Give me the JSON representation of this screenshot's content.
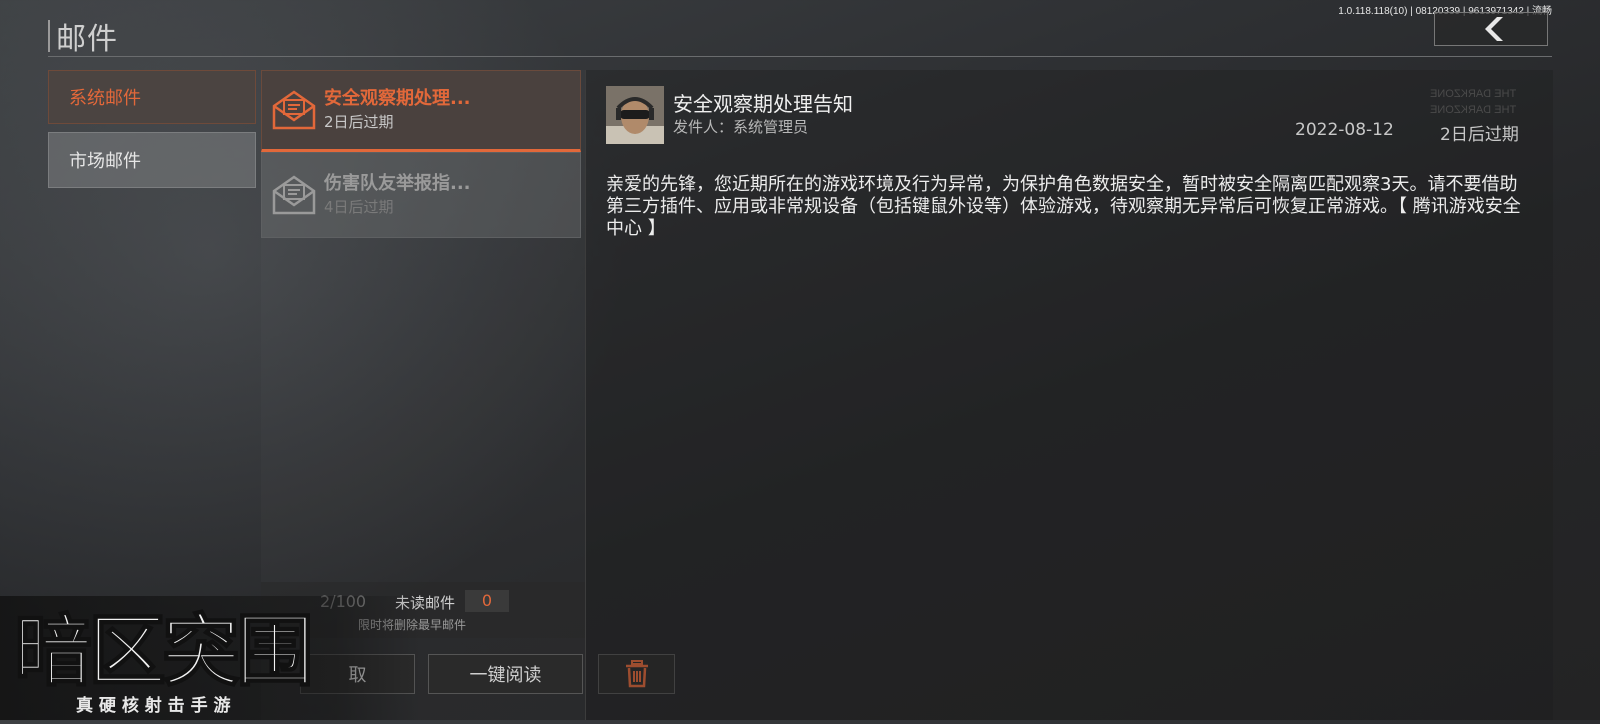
{
  "version_text": "1.0.118.118(10) | 08120339 | 9613971342 | 流畅",
  "page_title": "邮件",
  "categories": [
    {
      "label": "系统邮件",
      "active": true
    },
    {
      "label": "市场邮件",
      "active": false
    }
  ],
  "mails": [
    {
      "title": "安全观察期处理...",
      "expiry": "2日后过期",
      "selected": true
    },
    {
      "title": "伤害队友举报指...",
      "expiry": "4日后过期",
      "selected": false
    }
  ],
  "footer": {
    "count": "2/100",
    "unread_label": "未读邮件",
    "unread_count": "0",
    "limit_note": "限时将删除最早邮件"
  },
  "buttons": {
    "collect_label": "取",
    "read_all_label": "一键阅读"
  },
  "detail": {
    "title": "安全观察期处理告知",
    "sender": "发件人：系统管理员",
    "date": "2022-08-12",
    "expiry": "2日后过期",
    "body": "亲爱的先锋，您近期所在的游戏环境及行为异常，为保护角色数据安全，暂时被安全隔离匹配观察3天。请不要借助第三方插件、应用或非常规设备（包括键鼠外设等）体验游戏，待观察期无异常后可恢复正常游戏。【 腾讯游戏安全中心 】",
    "watermark_line1": "THE DARKZONE",
    "watermark_line2": "THE DARKZONE"
  },
  "logo": {
    "main": "暗区突围",
    "tagline": "真 硬 核 射 击 手 游"
  },
  "colors": {
    "accent": "#e2683a"
  }
}
